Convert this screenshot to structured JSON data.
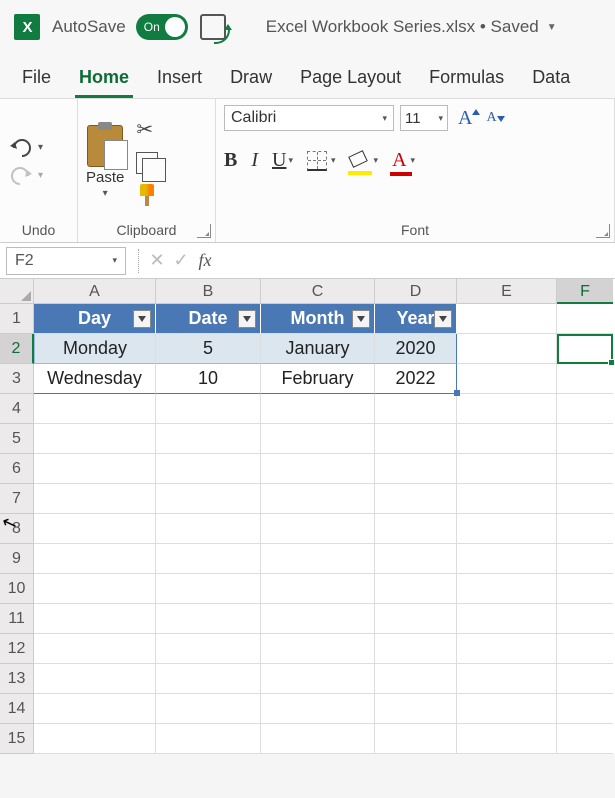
{
  "titlebar": {
    "autosave_label": "AutoSave",
    "autosave_state": "On",
    "doc_title": "Excel Workbook Series.xlsx • Saved"
  },
  "tabs": [
    "File",
    "Home",
    "Insert",
    "Draw",
    "Page Layout",
    "Formulas",
    "Data"
  ],
  "active_tab": "Home",
  "ribbon": {
    "undo_group": "Undo",
    "clipboard_group": "Clipboard",
    "paste_label": "Paste",
    "font_group": "Font",
    "font_name": "Calibri",
    "font_size": "11"
  },
  "namebox": "F2",
  "formula": "",
  "columns": [
    "A",
    "B",
    "C",
    "D",
    "E"
  ],
  "row_numbers": [
    1,
    2,
    3,
    4,
    5,
    6,
    7,
    8,
    9,
    10,
    11,
    12,
    13,
    14,
    15
  ],
  "chart_data": {
    "type": "table",
    "headers": [
      "Day",
      "Date",
      "Month",
      "Year"
    ],
    "rows": [
      {
        "Day": "Monday",
        "Date": 5,
        "Month": "January",
        "Year": 2020
      },
      {
        "Day": "Wednesday",
        "Date": 10,
        "Month": "February",
        "Year": 2022
      }
    ]
  }
}
